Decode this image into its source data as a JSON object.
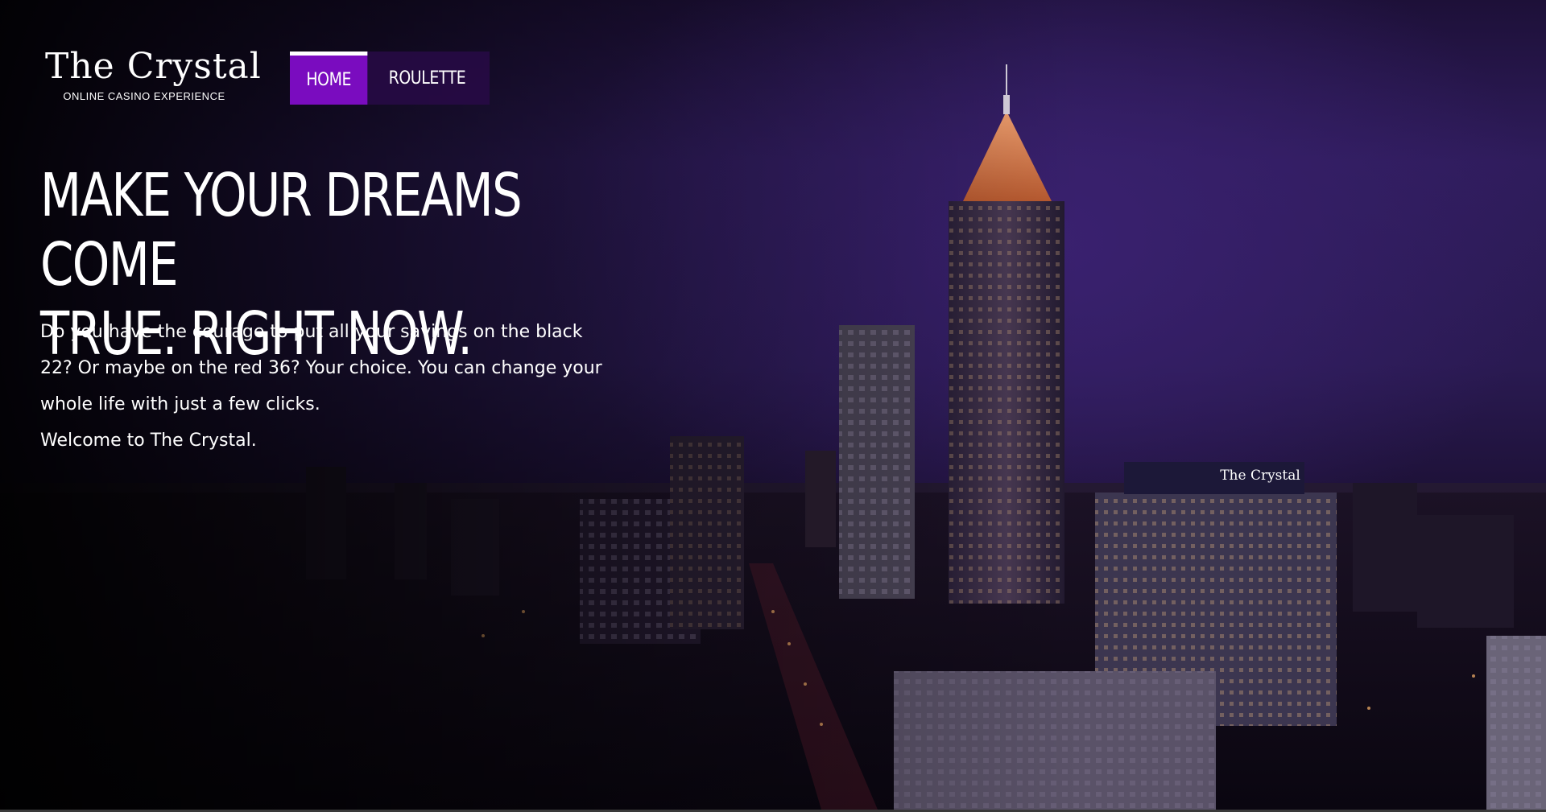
{
  "brand": {
    "title": "The Crystal",
    "subtitle": "ONLINE CASINO EXPERIENCE"
  },
  "nav": {
    "items": [
      {
        "label": "HOME",
        "active": true
      },
      {
        "label": "ROULETTE",
        "active": false
      }
    ]
  },
  "hero": {
    "headline_line1": "MAKE YOUR DREAMS COME",
    "headline_line2": "TRUE. RIGHT NOW.",
    "paragraph": "Do you have the courage to put all your savings on the black 22? Or maybe on the red 36? Your choice. You can change your whole life with just a few clicks.",
    "welcome": "Welcome to The Crystal.",
    "building_sign": "The Crystal"
  },
  "colors": {
    "nav_active": "#7a0cbf",
    "nav_background": "#280a46",
    "sky_purple": "#2f1c5c",
    "text": "#ffffff"
  }
}
